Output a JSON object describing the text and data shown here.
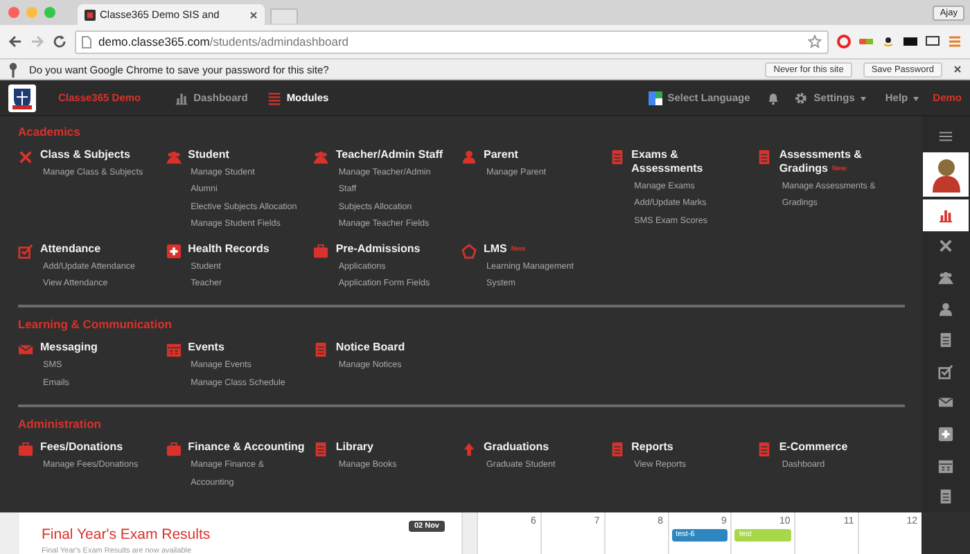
{
  "browser": {
    "tab_title": "Classe365 Demo SIS and",
    "user": "Ajay",
    "url_host": "demo.classe365.com",
    "url_path": "/students/admindashboard",
    "infobar": {
      "message": "Do you want Google Chrome to save your password for this site?",
      "buttons": [
        "Never for this site",
        "Save Password"
      ]
    }
  },
  "navbar": {
    "brand": "Classe365 Demo",
    "items": [
      {
        "label": "Dashboard",
        "kind": "chart",
        "selected": false
      },
      {
        "label": "Modules",
        "kind": "list",
        "selected": true
      }
    ],
    "language": "Select Language",
    "settings": "Settings",
    "help": "Help",
    "user": "Demo"
  },
  "sections": [
    {
      "title": "Academics",
      "groups": [
        {
          "title": "Class & Subjects",
          "kind": "tools",
          "links": [
            "Manage Class & Subjects"
          ]
        },
        {
          "title": "Student",
          "kind": "group",
          "links": [
            "Manage Student",
            "Alumni",
            "Elective Subjects Allocation",
            "Manage Student Fields"
          ]
        },
        {
          "title": "Teacher/Admin Staff",
          "kind": "group",
          "links": [
            "Manage Teacher/Admin Staff",
            "Subjects Allocation",
            "Manage Teacher Fields"
          ]
        },
        {
          "title": "Parent",
          "kind": "person",
          "links": [
            "Manage Parent"
          ]
        },
        {
          "title": "Exams & Assessments",
          "kind": "doc",
          "links": [
            "Manage Exams",
            "Add/Update Marks",
            "SMS Exam Scores"
          ]
        },
        {
          "title": "Assessments & Gradings",
          "badge": "New",
          "kind": "doc",
          "links": [
            "Manage Assessments & Gradings"
          ]
        },
        {
          "title": "Attendance",
          "kind": "check",
          "links": [
            "Add/Update Attendance",
            "View Attendance"
          ]
        },
        {
          "title": "Health Records",
          "kind": "medical",
          "links": [
            "Student",
            "Teacher"
          ]
        },
        {
          "title": "Pre-Admissions",
          "kind": "briefcase",
          "links": [
            "Applications",
            "Application Form Fields"
          ]
        },
        {
          "title": "LMS",
          "badge": "New",
          "kind": "home",
          "links": [
            "Learning Management System"
          ]
        }
      ]
    },
    {
      "title": "Learning & Communication",
      "groups": [
        {
          "title": "Messaging",
          "kind": "mail",
          "links": [
            "SMS",
            "Emails"
          ]
        },
        {
          "title": "Events",
          "kind": "calendar",
          "links": [
            "Manage Events",
            "Manage Class Schedule"
          ]
        },
        {
          "title": "Notice Board",
          "kind": "doc",
          "links": [
            "Manage Notices"
          ]
        }
      ]
    },
    {
      "title": "Administration",
      "groups": [
        {
          "title": "Fees/Donations",
          "kind": "briefcase",
          "links": [
            "Manage Fees/Donations"
          ]
        },
        {
          "title": "Finance & Accounting",
          "kind": "briefcase",
          "links": [
            "Manage Finance & Accounting"
          ]
        },
        {
          "title": "Library",
          "kind": "doc",
          "links": [
            "Manage Books"
          ]
        },
        {
          "title": "Graduations",
          "kind": "up",
          "links": [
            "Graduate Student"
          ]
        },
        {
          "title": "Reports",
          "kind": "doc",
          "links": [
            "View Reports"
          ]
        },
        {
          "title": "E-Commerce",
          "kind": "doc",
          "links": [
            "Dashboard"
          ]
        }
      ]
    }
  ],
  "sidebar": {
    "items": [
      {
        "kind": "menu",
        "selected": false
      },
      {
        "kind": "avatar",
        "selected": true
      },
      {
        "kind": "chart",
        "selected": true
      },
      {
        "kind": "tools",
        "selected": false
      },
      {
        "kind": "group",
        "selected": false
      },
      {
        "kind": "person",
        "selected": false
      },
      {
        "kind": "doc",
        "selected": false
      },
      {
        "kind": "check",
        "selected": false
      },
      {
        "kind": "mail",
        "selected": false
      },
      {
        "kind": "medical",
        "selected": false
      },
      {
        "kind": "calendar",
        "selected": false
      },
      {
        "kind": "doc",
        "selected": false
      }
    ]
  },
  "feed": {
    "title": "Final Year's Exam Results",
    "date": "02 Nov",
    "summary": "Final Year's Exam Results are now available"
  },
  "calendar": {
    "days": [
      {
        "label": "6"
      },
      {
        "label": "7"
      },
      {
        "label": "8"
      },
      {
        "label": "9",
        "events": [
          {
            "title": "test-6",
            "color": "#2e86c1"
          }
        ]
      },
      {
        "label": "10",
        "events": [
          {
            "title": "test",
            "color": "#a8d84a"
          }
        ]
      },
      {
        "label": "11"
      },
      {
        "label": "12"
      }
    ]
  }
}
